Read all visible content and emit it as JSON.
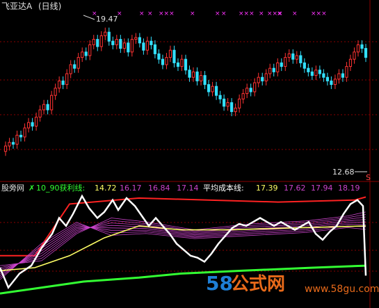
{
  "header": {
    "title": "飞亚达A",
    "period": "(日线)"
  },
  "colors": {
    "up": "#ff3333",
    "down": "#33e0ff",
    "grid": "#8b0000",
    "profit_line": "#ffff66",
    "cost_line": "#ffff66",
    "white_line": "#ffffff",
    "red_line": "#ff2222",
    "green_line": "#33ff33",
    "magenta": "#cc44cc",
    "marker": "#ff33ff"
  },
  "top_chart": {
    "high_label": "19.47",
    "low_label": "12.68",
    "last_marker": "S",
    "x_markers": [
      "×",
      "×",
      "×",
      "×",
      "×××",
      "×",
      "×",
      "×",
      "×××",
      "×",
      "×××",
      "×",
      "×",
      "×××"
    ]
  },
  "indicator_bar": {
    "name": "股旁网",
    "profit_label": "10_90获利线:",
    "profit_values": [
      "14.72",
      "16.17",
      "16.84",
      "17.14"
    ],
    "cost_label": "平均成本线:",
    "cost_values": [
      "17.39",
      "17.62",
      "17.94",
      "18.19"
    ]
  },
  "watermark": {
    "brand_num": "58",
    "brand_cn": "公式网",
    "url": "www.58gu.com"
  },
  "chart_data": [
    {
      "type": "candlestick",
      "title": "飞亚达A (日线)",
      "ylim": [
        12.0,
        20.0
      ],
      "annotations": [
        "19.47",
        "12.68"
      ],
      "series": [
        {
          "name": "close",
          "values": [
            13.0,
            13.2,
            13.1,
            13.6,
            13.5,
            14.0,
            14.3,
            14.1,
            14.6,
            15.0,
            15.3,
            15.0,
            15.8,
            16.2,
            16.6,
            16.4,
            17.0,
            17.5,
            17.3,
            17.9,
            18.2,
            18.0,
            18.6,
            18.9,
            18.5,
            19.1,
            19.3,
            18.8,
            18.6,
            18.9,
            18.4,
            18.7,
            18.2,
            18.9,
            19.0,
            18.7,
            18.3,
            18.8,
            18.6,
            18.1,
            17.8,
            17.5,
            17.9,
            18.3,
            17.6,
            17.4,
            17.8,
            17.2,
            16.8,
            17.1,
            16.6,
            16.9,
            16.4,
            16.0,
            16.3,
            15.8,
            15.6,
            15.2,
            15.4,
            14.9,
            15.1,
            15.6,
            15.9,
            16.2,
            16.0,
            16.5,
            16.8,
            16.6,
            17.0,
            17.3,
            17.1,
            17.6,
            17.4,
            17.9,
            18.1,
            17.8,
            18.0,
            17.6,
            17.3,
            17.1,
            16.9,
            17.2,
            17.0,
            16.8,
            16.6,
            16.4,
            16.7,
            17.0,
            16.8,
            17.4,
            17.8,
            18.2,
            18.6,
            18.4,
            17.9
          ]
        }
      ]
    },
    {
      "type": "line",
      "title": "",
      "ylim": [
        0,
        100
      ],
      "series": [
        {
          "name": "10_90获利线",
          "values": [
            14.72,
            16.17,
            16.84,
            17.14
          ]
        },
        {
          "name": "平均成本线",
          "values": [
            17.39,
            17.62,
            17.94,
            18.19
          ]
        }
      ]
    }
  ]
}
